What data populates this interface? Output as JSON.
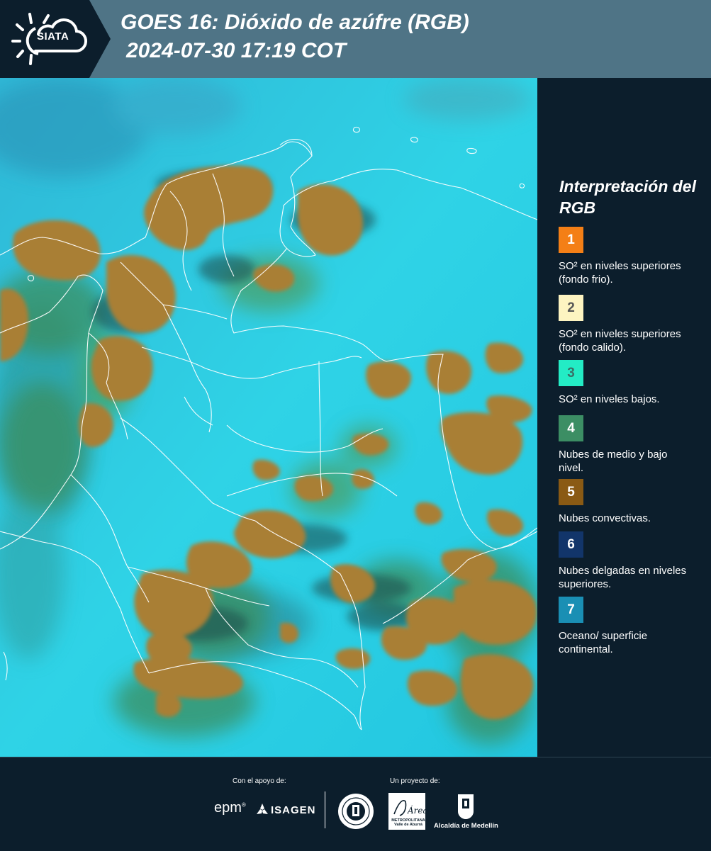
{
  "header": {
    "logo_text": "SIATA",
    "title": "GOES 16: Dióxido de azúfre (RGB)",
    "subtitle": " 2024-07-30 17:19 COT"
  },
  "colors": {
    "header_bg": "#4f7486",
    "logo_bg": "#0c1e2c",
    "page_bg": "#0c1e2c",
    "map_background": "#22c8e0",
    "cloud_convective": "#a97f36",
    "cloud_mid_low": "#3b8e5f",
    "border_lines": "#ffffff"
  },
  "legend": {
    "title": "Interpretación del RGB",
    "items": [
      {
        "number": "1",
        "color": "#f47f16",
        "text_color": "#ffffff",
        "label": "SO² en niveles superiores (fondo frio)."
      },
      {
        "number": "2",
        "color": "#fdf4c1",
        "text_color": "#555555",
        "label": "SO² en niveles superiores (fondo calido)."
      },
      {
        "number": "3",
        "color": "#23ecc5",
        "text_color": "#3a6f66",
        "label": "SO² en niveles bajos."
      },
      {
        "number": "4",
        "color": "#3c8e64",
        "text_color": "#ffffff",
        "label": "Nubes de medio y bajo nivel."
      },
      {
        "number": "5",
        "color": "#8a5a14",
        "text_color": "#ffffff",
        "label": "Nubes convectivas."
      },
      {
        "number": "6",
        "color": "#12356a",
        "text_color": "#ffffff",
        "label": "Nubes delgadas en niveles superiores."
      },
      {
        "number": "7",
        "color": "#1a8fb4",
        "text_color": "#ffffff",
        "label": "Oceano/ superficie continental."
      }
    ]
  },
  "footer": {
    "support_label": "Con el apoyo de:",
    "project_label": "Un proyecto de:",
    "epm": "epm",
    "isagen": "ISAGEN",
    "area_name": "Área",
    "area_sub": "METROPOLITANA Valle de Aburrá",
    "alcaldia": "Alcaldía de Medellín"
  }
}
